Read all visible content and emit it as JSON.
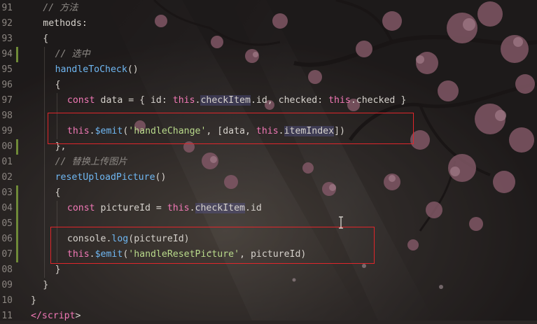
{
  "editor": {
    "line_numbers": [
      "91",
      "92",
      "93",
      "94",
      "95",
      "96",
      "97",
      "98",
      "99",
      "00",
      "01",
      "02",
      "03",
      "04",
      "05",
      "06",
      "07",
      "08",
      "09",
      "10",
      "11"
    ],
    "lines": [
      [
        {
          "t": "cmt",
          "v": "// 方法"
        }
      ],
      [
        {
          "t": "plain",
          "v": "methods:"
        }
      ],
      [
        {
          "t": "plain",
          "v": "{"
        }
      ],
      [
        {
          "t": "cmt",
          "v": "// 选中"
        }
      ],
      [
        {
          "t": "fn",
          "v": "handleToCheck"
        },
        {
          "t": "plain",
          "v": "()"
        }
      ],
      [
        {
          "t": "plain",
          "v": "{"
        }
      ],
      [
        {
          "t": "kw",
          "v": "const "
        },
        {
          "t": "var",
          "v": "data = { id: "
        },
        {
          "t": "this",
          "v": "this"
        },
        {
          "t": "plain",
          "v": "."
        },
        {
          "t": "prop",
          "v": "checkItem"
        },
        {
          "t": "plain",
          "v": ".id, checked: "
        },
        {
          "t": "this",
          "v": "this"
        },
        {
          "t": "plain",
          "v": ".checked }"
        }
      ],
      [],
      [
        {
          "t": "this",
          "v": "this"
        },
        {
          "t": "plain",
          "v": "."
        },
        {
          "t": "fn",
          "v": "$emit"
        },
        {
          "t": "plain",
          "v": "("
        },
        {
          "t": "str",
          "v": "'handleChange'"
        },
        {
          "t": "plain",
          "v": ", [data, "
        },
        {
          "t": "this",
          "v": "this"
        },
        {
          "t": "plain",
          "v": "."
        },
        {
          "t": "prop",
          "v": "itemIndex"
        },
        {
          "t": "plain",
          "v": "])"
        }
      ],
      [
        {
          "t": "plain",
          "v": "},"
        }
      ],
      [
        {
          "t": "cmt",
          "v": "// 替换上传图片"
        }
      ],
      [
        {
          "t": "fn",
          "v": "resetUploadPicture"
        },
        {
          "t": "plain",
          "v": "()"
        }
      ],
      [
        {
          "t": "plain",
          "v": "{"
        }
      ],
      [
        {
          "t": "kw",
          "v": "const "
        },
        {
          "t": "var",
          "v": "pictureId = "
        },
        {
          "t": "this",
          "v": "this"
        },
        {
          "t": "plain",
          "v": "."
        },
        {
          "t": "prop",
          "v": "checkItem"
        },
        {
          "t": "plain",
          "v": ".id"
        }
      ],
      [],
      [
        {
          "t": "plain",
          "v": "console."
        },
        {
          "t": "fn",
          "v": "log"
        },
        {
          "t": "plain",
          "v": "(pictureId)"
        }
      ],
      [
        {
          "t": "this",
          "v": "this"
        },
        {
          "t": "plain",
          "v": "."
        },
        {
          "t": "fn",
          "v": "$emit"
        },
        {
          "t": "plain",
          "v": "("
        },
        {
          "t": "str",
          "v": "'handleResetPicture'"
        },
        {
          "t": "plain",
          "v": ", pictureId)"
        }
      ],
      [
        {
          "t": "plain",
          "v": "}"
        }
      ],
      [
        {
          "t": "plain",
          "v": "}"
        }
      ],
      [
        {
          "t": "plain",
          "v": "}"
        }
      ],
      [
        {
          "t": "tag",
          "v": "</"
        },
        {
          "t": "tag",
          "v": "script"
        },
        {
          "t": "plain",
          "v": ">"
        }
      ]
    ],
    "indents": [
      1,
      1,
      1,
      2,
      2,
      2,
      3,
      3,
      3,
      2,
      2,
      2,
      2,
      3,
      3,
      3,
      3,
      2,
      1,
      0,
      0
    ]
  }
}
